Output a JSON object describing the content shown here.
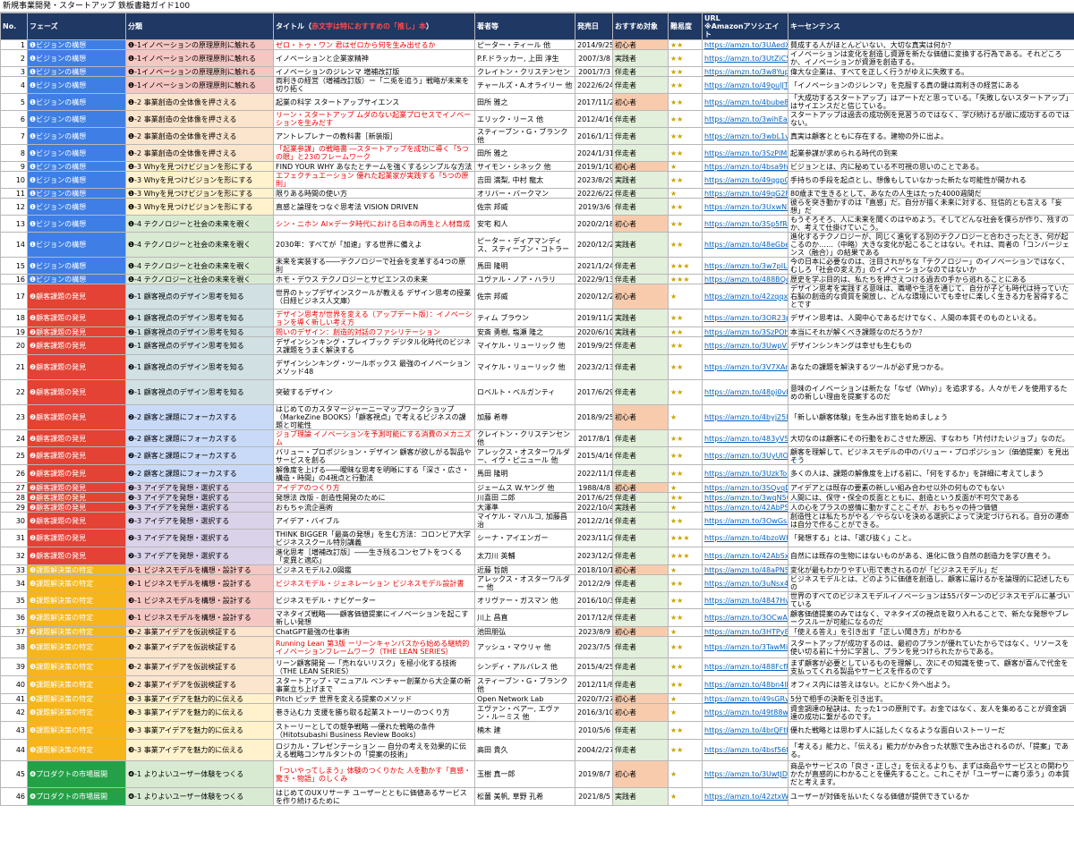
{
  "sheet_title": "新規事業開発・スタートアップ 鉄板書籍ガイド100",
  "headers": {
    "no": "No.",
    "phase": "フェーズ",
    "category": "分類",
    "title_prefix": "タイトル（",
    "title_highlight": "赤文字は特におすすめの「推し」本",
    "title_suffix": "）",
    "author": "著者等",
    "date": "発売日",
    "target": "おすすめ対象",
    "difficulty": "難易度",
    "url": "URL\n※Amazonアソシエイト",
    "keysentence": "キーセンテンス"
  },
  "rows": [
    {
      "no": "1",
      "phase": "❶ビジョンの構想",
      "cat": "❶-1イノベーションの原理原則に触れる",
      "title": "ゼロ・トゥ・ワン 君はゼロから何を生み出せるか",
      "red": true,
      "author": "ピーター・ティール 他",
      "date": "2014/9/25",
      "target": "初心者",
      "diff": "★★",
      "url": "https://amzn.to/3UAedXv",
      "kw": "賛成する人がほとんどいない、大切な真実は何か？"
    },
    {
      "no": "2",
      "phase": "❶ビジョンの構想",
      "cat": "❶-1イノベーションの原理原則に触れる",
      "title": "イノベーションと企業家精神",
      "red": false,
      "author": "P.F.ドラッカー, 上田 淳生",
      "date": "2007/3/8",
      "target": "実践者",
      "diff": "★★",
      "url": "https://amzn.to/3UtZiC5",
      "kw": "イノベーションは変化を創造し資源を新たな価値に変換する行為である。それどころか、イノベーションが資源を創造する。"
    },
    {
      "no": "3",
      "phase": "❶ビジョンの構想",
      "cat": "❶-1イノベーションの原理原則に触れる",
      "title": "イノベーションのジレンマ 増補改訂版",
      "red": false,
      "author": "クレイトン・クリステンセン",
      "date": "2001/7/3",
      "target": "伴走者",
      "diff": "★★",
      "url": "https://amzn.to/3w8Yup5",
      "kw": "偉大な企業は、すべてを正しく行うがゆえに失敗する。"
    },
    {
      "no": "4",
      "phase": "❶ビジョンの構想",
      "cat": "❶-1イノベーションの原理原則に触れる",
      "title": "両利きの経営（増補改訂版）ー「二兎を追う」戦略が未来を切り拓く",
      "red": false,
      "author": "チャールズ・A.オライリー 他",
      "date": "2022/6/24",
      "target": "伴走者",
      "diff": "★★",
      "url": "https://amzn.to/49pulJT",
      "kw": "「イノベーションのジレンマ」を克服する真の鍵は両利きの経営にある"
    },
    {
      "no": "5",
      "phase": "❶ビジョンの構想",
      "cat": "❶-2 事業創造の全体像を押さえる",
      "title": "起業の科学 スタートアップサイエンス",
      "red": false,
      "author": "田所 雅之",
      "date": "2017/11/2",
      "target": "初心者",
      "diff": "★★",
      "url": "https://amzn.to/4bube8O",
      "kw": "「大成功するスタートアップ」はアートだと思っている。「失敗しないスタートアップ」はサイエンスだと信じている。"
    },
    {
      "no": "6",
      "phase": "❶ビジョンの構想",
      "cat": "❶-2 事業創造の全体像を押さえる",
      "title": "リーン・スタートアップ ムダのない起業プロセスでイノベーションを生みだす",
      "red": true,
      "author": "エリック・リース 他",
      "date": "2012/4/16",
      "target": "伴走者",
      "diff": "★★",
      "url": "https://amzn.to/3wihEaE",
      "kw": "スタートアップは過去の成功例を見習うのではなく、学び続けるが故に成功するのではない。"
    },
    {
      "no": "7",
      "phase": "❶ビジョンの構想",
      "cat": "❶-2 事業創造の全体像を押さえる",
      "title": "アントレプレナーの教科書［新装版］",
      "red": false,
      "author": "スティーブン・G・ブランク 他",
      "date": "2016/1/13",
      "target": "伴走者",
      "diff": "★★",
      "url": "https://amzn.to/3wbL1vO",
      "kw": "真実は顧客とともに存在する。建物の外に出よ。"
    },
    {
      "no": "8",
      "phase": "❶ビジョンの構想",
      "cat": "❶-2 事業創造の全体像を押さえる",
      "title": "「起業参謀」の戦略書 ―スタートアップを成功に導く「5つの眼」と23のフレームワーク",
      "red": true,
      "author": "田所 雅之",
      "date": "2024/1/31",
      "target": "伴走者",
      "diff": "★★",
      "url": "https://amzn.to/3SzPlMU",
      "kw": "起業参謀が求められる時代の到来"
    },
    {
      "no": "9",
      "phase": "❶ビジョンの構想",
      "cat": "❶-3 Whyを見つけビジョンを形にする",
      "title": "FIND YOUR WHY あなたとチームを強くするシンプルな方法",
      "red": false,
      "author": "サイモン・シネック 他",
      "date": "2019/1/10",
      "target": "初心者",
      "diff": "★",
      "url": "https://amzn.to/4bsa9hX",
      "kw": "ビジョンとは、内に秘めている不可視の思いのことである。"
    },
    {
      "no": "10",
      "phase": "❶ビジョンの構想",
      "cat": "❶-3 Whyを見つけビジョンを形にする",
      "title": "エフェクチュエーション 優れた起業家が実践する「5つの原則」",
      "red": true,
      "author": "吉田 満梨, 中村 龍太",
      "date": "2023/8/29",
      "target": "実践者",
      "diff": "★★",
      "url": "https://amzn.to/49qgpQ5",
      "kw": "手持ちの手段を起点とし、想像もしていなかった新たな可能性が開かれる"
    },
    {
      "no": "11",
      "phase": "❶ビジョンの構想",
      "cat": "❶-3 Whyを見つけビジョンを形にする",
      "title": "限りある時間の使い方",
      "red": false,
      "author": "オリバー・バークマン",
      "date": "2022/6/22",
      "target": "伴走者",
      "diff": "★",
      "url": "https://amzn.to/49qG2Fm",
      "kw": "80歳まで生きるとして、あなたの人生はたった4000週間だ"
    },
    {
      "no": "12",
      "phase": "❶ビジョンの構想",
      "cat": "❶-3 Whyを見つけビジョンを形にする",
      "title": "直感と論理をつなぐ思考法 VISION DRIVEN",
      "red": false,
      "author": "佐宗 邦威",
      "date": "2019/3/6",
      "target": "伴走者",
      "diff": "★★",
      "url": "https://amzn.to/3UxwN2c",
      "kw": "彼らを突き動かすのは「直感」だ。自分が描く未来に対する、狂信的とも言える「妄想」だ"
    },
    {
      "no": "13",
      "phase": "❶ビジョンの構想",
      "cat": "❶-4 テクノロジーと社会の未来を覗く",
      "title": "シン・ニホン AI×データ時代における日本の再生と人材育成",
      "red": true,
      "author": "安宅 和人",
      "date": "2020/2/18",
      "target": "初心者",
      "diff": "★★",
      "url": "https://amzn.to/3Sp5fRe",
      "kw": "もうそろそろ、人に未来を聞くのはやめよう。そしてどんな社会を僕らが作り、残すのか、考えて仕掛けていこう。"
    },
    {
      "no": "14",
      "phase": "❶ビジョンの構想",
      "cat": "❶-4 テクノロジーと社会の未来を覗く",
      "title": "2030年：すべてが「加速」する世界に備えよ",
      "red": false,
      "author": "ピーター・ディアマンディス、スティーブン・コトラー",
      "date": "2020/12/22",
      "target": "実践者",
      "diff": "★★",
      "url": "https://amzn.to/48eGbeg",
      "kw": "進化するテクノロジーが、同じく進化する別のテクノロジーと合わさったとき、何が起こるのか……（中略）大きな変化が起こることはない。それは、両者の「コンバージェンス（融合）」の結果である"
    },
    {
      "no": "15",
      "phase": "❶ビジョンの構想",
      "cat": "❶-4 テクノロジーと社会の未来を覗く",
      "title": "未来を実装する――テクノロジーで社会を変革する4つの原則",
      "red": false,
      "author": "馬田 隆明",
      "date": "2021/1/24",
      "target": "伴走者",
      "diff": "★★★",
      "url": "https://amzn.to/3w7pILH",
      "kw": "今の日本に必要なのは、注目されがちな「テクノロジー」のイノベーションではなく、むしろ「社会の変え方」のイノベーションなのではないか"
    },
    {
      "no": "16",
      "phase": "❶ビジョンの構想",
      "cat": "❶-4 テクノロジーと社会の未来を覗く",
      "title": "ホモ・デウス テクノロジーとサピエンスの未来",
      "red": false,
      "author": "ユヴァル・ノア・ハラリ",
      "date": "2022/9/13",
      "target": "伴走者",
      "diff": "★★★",
      "url": "https://amzn.to/488BQcL",
      "kw": "歴史を学ぶ目的は、私たちを押さえつける過去の手から逃れることにある"
    },
    {
      "no": "17",
      "phase": "❷顧客課題の発見",
      "cat": "❷-1 顧客視点のデザイン思考を知る",
      "title": "世界のトップデザインスクールが教える デザイン思考の授業（日経ビジネス人文庫）",
      "red": false,
      "author": "佐宗 邦威",
      "date": "2020/12/2",
      "target": "初心者",
      "diff": "★",
      "url": "https://amzn.to/42zqqxi",
      "kw": "デザイン思考を実践する意味は、職場や生活を通じて、自分が子ども時代は持っていた右脳の創造的な資質を開放し、どんな環境にいても幸せに楽しく生きる力を習得することです"
    },
    {
      "no": "18",
      "phase": "❷顧客課題の発見",
      "cat": "❷-1 顧客視点のデザイン思考を知る",
      "title": "デザイン思考が世界を変える〔アップデート版〕：イノベーションを導く新しい考え方",
      "red": true,
      "author": "ティム ブラウン",
      "date": "2019/11/20",
      "target": "実践者",
      "diff": "★★",
      "url": "https://amzn.to/3OR23pv",
      "kw": "デザイン思考は、人間中心であるだけでなく、人間の本質そのものといえる。"
    },
    {
      "no": "19",
      "phase": "❷顧客課題の発見",
      "cat": "❷-1 顧客視点のデザイン思考を知る",
      "title": "問いのデザイン：創造的対話のファシリテーション",
      "red": true,
      "author": "安斎 勇樹, 塩瀬 隆之",
      "date": "2020/6/10",
      "target": "実践者",
      "diff": "★★",
      "url": "https://amzn.to/3SzPOhU",
      "kw": "本当にそれが解くべき課題なのだろうか？"
    },
    {
      "no": "20",
      "phase": "❷顧客課題の発見",
      "cat": "❷-1 顧客視点のデザイン思考を知る",
      "title": "デザインシンキング・プレイブック デジタル化時代のビジネス課題をうまく解決する",
      "red": false,
      "author": "マイケル・リューリック 他",
      "date": "2019/9/25",
      "target": "伴走者",
      "diff": "★★",
      "url": "https://amzn.to/3UwpV5e",
      "kw": "デザインシンキングは幸せも生むもの"
    },
    {
      "no": "21",
      "phase": "❷顧客課題の発見",
      "cat": "❷-1 顧客視点のデザイン思考を知る",
      "title": "デザインシンキング・ツールボックス 最強のイノベーションメソッド48",
      "red": false,
      "author": "マイケル・リューリック 他",
      "date": "2023/2/13",
      "target": "伴走者",
      "diff": "★★",
      "url": "https://amzn.to/3V7XAmk",
      "kw": "あなたの課題を解決するツールが必ず見つかる。"
    },
    {
      "no": "22",
      "phase": "❷顧客課題の発見",
      "cat": "❷-1 顧客視点のデザイン思考を知る",
      "title": "突破するデザイン",
      "red": false,
      "author": "ロベルト・ベルガンティ",
      "date": "2017/6/29",
      "target": "伴走者",
      "diff": "★★",
      "url": "https://amzn.to/48pj0vI",
      "kw": "意味のイノベーションは新たな「なぜ（Why）」を追求する。人々がモノを使用するための新しい理由を提案するのだ"
    },
    {
      "no": "23",
      "phase": "❷顧客課題の発見",
      "cat": "❷-2 顧客と課題にフォーカスする",
      "title": "はじめてのカスタマージャーニーマップワークショップ（MarkeZine BOOKS）「顧客視点」で考えるビジネスの課題と可能性",
      "red": false,
      "author": "加藤 希尊",
      "date": "2018/9/25",
      "target": "初心者",
      "diff": "★",
      "url": "https://amzn.to/4byj25l",
      "kw": "「新しい顧客体験」を生み出す旅を始めましょう"
    },
    {
      "no": "24",
      "phase": "❷顧客課題の発見",
      "cat": "❷-2 顧客と課題にフォーカスする",
      "title": "ジョブ理論 イノベーションを予測可能にする消費のメカニズム",
      "red": true,
      "author": "クレイトン・クリステンセン 他",
      "date": "2017/8/1",
      "target": "伴走者",
      "diff": "★★",
      "url": "https://amzn.to/483yVSA",
      "kw": "大切なのは顧客にその行動をおこさせた原因、すなわち「片付けたいジョブ」なのだ。"
    },
    {
      "no": "25",
      "phase": "❷顧客課題の発見",
      "cat": "❷-2 顧客と課題にフォーカスする",
      "title": "バリュー・プロポジション・デザイン 顧客が欲しがる製品やサービスを創る",
      "red": false,
      "author": "アレックス・オスターワルダー、イヴ・ピニュール 他",
      "date": "2015/4/16",
      "target": "伴走者",
      "diff": "★★",
      "url": "https://amzn.to/3UyUlOX",
      "kw": "顧客を理解して、ビジネスモデルの中のバリュー・プロポジション（価値提案）を見出そう"
    },
    {
      "no": "26",
      "phase": "❷顧客課題の発見",
      "cat": "❷-2 顧客と課題にフォーカスする",
      "title": "解像度を上げる――曖昧な思考を明晰にする「深さ・広さ・構造・時間」の4視点と行動法",
      "red": false,
      "author": "馬田 隆明",
      "date": "2022/11/19",
      "target": "伴走者",
      "diff": "★★",
      "url": "https://amzn.to/3UzkToP",
      "kw": "多くの人は、課題の解像度を上げる前に、「何をするか」を詳細に考えてしまう"
    },
    {
      "no": "27",
      "phase": "❷顧客課題の発見",
      "cat": "❷-3 アイデアを発想・選択する",
      "title": "アイデアのつくり方",
      "red": true,
      "author": "ジェームス W.ヤング 他",
      "date": "1988/4/8",
      "target": "初心者",
      "diff": "★",
      "url": "https://amzn.to/3SQvqDS",
      "kw": "アイデアとは既存の要素の新しい組み合わせ以外の何ものでもない"
    },
    {
      "no": "28",
      "phase": "❷顧客課題の発見",
      "cat": "❷-3 アイデアを発想・選択する",
      "title": "発想法 改版 - 創造性開発のために",
      "red": false,
      "author": "川喜田 二郎",
      "date": "2017/6/25",
      "target": "伴走者",
      "diff": "★★",
      "url": "https://amzn.to/3wqN5Ct",
      "kw": "人間には、保守・保全の反面とともに、創造という反面が不可欠である"
    },
    {
      "no": "29",
      "phase": "❷顧客課題の発見",
      "cat": "❷-3 アイデアを発想・選択する",
      "title": "おもちゃ流企画術",
      "red": false,
      "author": "大澤準",
      "date": "2022/10/4",
      "target": "実践者",
      "diff": "★",
      "url": "https://amzn.to/42AbPSE",
      "kw": "人の心をプラスの感情に動かすことこそが、おもちゃの持つ価値"
    },
    {
      "no": "30",
      "phase": "❷顧客課題の発見",
      "cat": "❷-3 アイデアを発想・選択する",
      "title": "アイデア・バイブル",
      "red": false,
      "author": "マイケル・マハルコ, 加藤昌治",
      "date": "2012/2/16",
      "target": "伴走者",
      "diff": "★★",
      "url": "https://amzn.to/3OwGsm8",
      "kw": "創造性とは私たちがやる／やらないを決める選択によって決定づけられる。自分の運命は自分で作ることができる。"
    },
    {
      "no": "31",
      "phase": "❷顧客課題の発見",
      "cat": "❷-3 アイデアを発想・選択する",
      "title": "THINK BIGGER「最高の発想」を生む方法：コロンビア大学ビジネススクール特別講義",
      "red": false,
      "author": "シーナ・アイエンガー",
      "date": "2023/11/20",
      "target": "伴走者",
      "diff": "★★★",
      "url": "https://amzn.to/4bzoWHO",
      "kw": "「発想する」とは、「選び抜く」こと。"
    },
    {
      "no": "32",
      "phase": "❷顧客課題の発見",
      "cat": "❷-3 アイデアを発想・選択する",
      "title": "進化思考［増補改訂版］――生き残るコンセプトをつくる「変異と適応」",
      "red": false,
      "author": "太刀川 英輔",
      "date": "2023/12/23",
      "target": "伴走者",
      "diff": "★★★",
      "url": "https://amzn.to/42AbSxO",
      "kw": "自然には既存の生物にはないものがある、進化に倣う自然の創造力を学び直そう。"
    },
    {
      "no": "33",
      "phase": "❸課題解決策の特定",
      "cat": "❸-1 ビジネスモデルを構想・設計する",
      "title": "ビジネスモデル2.0図鑑",
      "red": false,
      "author": "近藤 哲朗",
      "date": "2018/10/12",
      "target": "初心者",
      "diff": "★",
      "url": "https://amzn.to/48aPN5W",
      "kw": "変化が最もわかりやすい形で表されるのが「ビジネスモデル」だ"
    },
    {
      "no": "34",
      "phase": "❸課題解決策の特定",
      "cat": "❸-1 ビジネスモデルを構想・設計する",
      "title": "ビジネスモデル・ジェネレーション ビジネスモデル設計書",
      "red": true,
      "author": "アレックス・オスターワルダー 他",
      "date": "2012/2/9",
      "target": "伴走者",
      "diff": "★★",
      "url": "https://amzn.to/3uNsx4h",
      "kw": "ビジネスモデルとは、どのように価値を創造し、顧客に届けるかを論理的に記述したもの"
    },
    {
      "no": "35",
      "phase": "❸課題解決策の特定",
      "cat": "❸-1 ビジネスモデルを構想・設計する",
      "title": "ビジネスモデル・ナビゲーター",
      "red": false,
      "author": "オリヴァー・ガスマン 他",
      "date": "2016/10/3",
      "target": "伴走者",
      "diff": "★★",
      "url": "https://amzn.to/4847Hvf",
      "kw": "世界のすべてのビジネスモデルイノベーションは55パターンのビジネスモデルに基づいている"
    },
    {
      "no": "36",
      "phase": "❸課題解決策の特定",
      "cat": "❸-1 ビジネスモデルを構想・設計する",
      "title": "マネタイズ戦略――顧客価値提案にイノベーションを起こす新しい発想",
      "red": false,
      "author": "川上 昌直",
      "date": "2017/12/6",
      "target": "伴走者",
      "diff": "★★",
      "url": "https://amzn.to/3OCwAqL",
      "kw": "顧客価値提案のみではなく、マネタイズの視点を取り入れることで、新たな発想やブレークスルーが可能になるのだ"
    },
    {
      "no": "37",
      "phase": "❸課題解決策の特定",
      "cat": "❸-2 事業アイデアを仮説検証する",
      "title": "ChatGPT最強の仕事術",
      "red": false,
      "author": "池田朋弘",
      "date": "2023/8/9",
      "target": "初心者",
      "diff": "★",
      "url": "https://amzn.to/3HTPy8w",
      "kw": "「使える答え」を引き出す「正しい聞き方」がわかる"
    },
    {
      "no": "38",
      "phase": "❸課題解決策の特定",
      "cat": "❸-2 事業アイデアを仮説検証する",
      "title": "Running Lean 第3版 ーリーンキャンバスから始める継続的イノベーションフレームワーク（THE LEAN SERIES）",
      "red": true,
      "author": "アッシュ・マウリャ 他",
      "date": "2023/7/5",
      "target": "伴走者",
      "diff": "★★",
      "url": "https://amzn.to/3TawMiD",
      "kw": "スタートアップが成功するのは、最初のプランが優れていたからではなく、リソースを使い切る前に十分に学習し、プランを見つけられたからである。"
    },
    {
      "no": "39",
      "phase": "❸課題解決策の特定",
      "cat": "❸-2 事業アイデアを仮説検証する",
      "title": "リーン顧客開発 ―「売れないリスク」を極小化する技術（THE LEAN SERIES）",
      "red": false,
      "author": "シンディ・アルバレス 他",
      "date": "2015/4/25",
      "target": "伴走者",
      "diff": "★★",
      "url": "https://amzn.to/488FcfR",
      "kw": "まず顧客が必要としているものを理解し、次にその知識を使って、顧客が喜んで代金を支払ってくれる製品やサービスを作るのです"
    },
    {
      "no": "40",
      "phase": "❸課題解決策の特定",
      "cat": "❸-2 事業アイデアを仮説検証する",
      "title": "スタートアップ・マニュアル ベンチャー創業から大企業の新事業立ち上げまで",
      "red": false,
      "author": "スティーブン・G・ブランク 他",
      "date": "2012/11/8",
      "target": "伴走者",
      "diff": "★★",
      "url": "https://amzn.to/48bn4lF",
      "kw": "オフィス内には答えはない。とにかく外へ出よう。"
    },
    {
      "no": "41",
      "phase": "❸課題解決策の特定",
      "cat": "❸-3 事業アイデアを魅力的に伝える",
      "title": "Pitch ピッチ 世界を変える提案のメソッド",
      "red": false,
      "author": "Open Network Lab",
      "date": "2020/7/27",
      "target": "初心者",
      "diff": "★",
      "url": "https://amzn.to/49sGRv0",
      "kw": "5分で相手の決断を引き出す。"
    },
    {
      "no": "42",
      "phase": "❸課題解決策の特定",
      "cat": "❸-3 事業アイデアを魅力的に伝える",
      "title": "巻き込む力 支援を勝ち取る起業ストーリーのつくり方",
      "red": false,
      "author": "エヴァン・ベアー, エヴァン・ルーミス 他",
      "date": "2016/3/10",
      "target": "初心者",
      "diff": "★",
      "url": "https://amzn.to/49t88wr",
      "kw": "資金調達の秘訣は、たった1つの原則です。お金ではなく、友人を集めることが資金調達の成功に繋がるのです。"
    },
    {
      "no": "43",
      "phase": "❸課題解決策の特定",
      "cat": "❸-3 事業アイデアを魅力的に伝える",
      "title": "ストーリーとしての競争戦略 ―優れた戦略の条件（Hitotsubashi Business Review Books）",
      "red": false,
      "author": "楠木 建",
      "date": "2010/5/6",
      "target": "伴走者",
      "diff": "★★",
      "url": "https://amzn.to/4brQFtN",
      "kw": "優れた戦略とは思わず人に話したくなるような面白いストーリーだ"
    },
    {
      "no": "44",
      "phase": "❸課題解決策の特定",
      "cat": "❸-3 事業アイデアを魅力的に伝える",
      "title": "ロジカル・プレゼンテーション ― 自分の考えを効果的に伝える戦略コンサルタントの「提案の技術」",
      "red": false,
      "author": "高田 貴久",
      "date": "2004/2/27",
      "target": "伴走者",
      "diff": "★★",
      "url": "https://amzn.to/4bsf56f",
      "kw": "「考える」能力と、「伝える」能力がかみ合った状態で生み出されるのが、「提案」である。"
    },
    {
      "no": "45",
      "phase": "❹プロダクトの市場展開",
      "cat": "❹-1 よりよいユーザー体験をつくる",
      "title": "「ついやってしまう」体験のつくりかた 人を動かす「直感・驚き・物語」のしくみ",
      "red": true,
      "author": "玉樹 真一郎",
      "date": "2019/8/7",
      "target": "初心者",
      "diff": "★",
      "url": "https://amzn.to/3UwtJDy",
      "kw": "商品やサービスの「良さ・正しさ」を伝えるよりも、まずは商品やサービスとの関わりかたが直感的にわかることを優先すること。これこそが「ユーザーに寄り添う」の本質だと考えます。"
    },
    {
      "no": "46",
      "phase": "❹プロダクトの市場展開",
      "cat": "❹-1 よりよいユーザー体験をつくる",
      "title": "はじめてのUXリサーチ ユーザーとともに価値あるサービスを作り続けるために",
      "red": false,
      "author": "松薗 美帆, 草野 孔希",
      "date": "2021/8/5",
      "target": "実践者",
      "diff": "★",
      "url": "https://amzn.to/42ztxW3",
      "kw": "ユーザーが対価を払いたくなる価値が提供できているか"
    }
  ]
}
